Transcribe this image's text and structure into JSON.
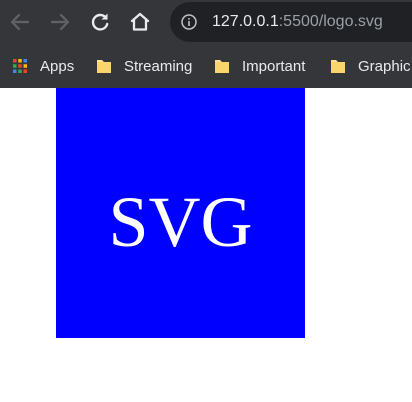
{
  "toolbar": {
    "back_icon": "arrow-left-icon",
    "forward_icon": "arrow-right-icon",
    "reload_icon": "reload-icon",
    "home_icon": "home-icon",
    "url_host": "127.0.0.1",
    "url_rest": ":5500/logo.svg"
  },
  "bookmarks": {
    "items": [
      {
        "label": "Apps",
        "icon": "apps-grid-icon"
      },
      {
        "label": "Streaming",
        "icon": "folder-icon"
      },
      {
        "label": "Important",
        "icon": "folder-icon"
      },
      {
        "label": "Graphic",
        "icon": "folder-icon"
      }
    ]
  },
  "content": {
    "logo_text": "SVG",
    "logo_bg": "#0000ff",
    "logo_text_color": "#ffffff"
  }
}
